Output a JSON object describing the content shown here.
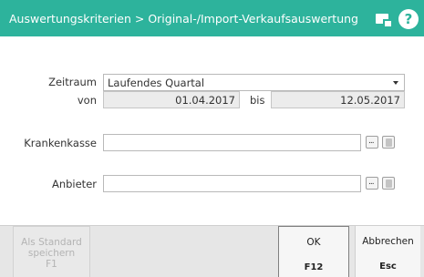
{
  "window": {
    "title": "Auswertungskriterien > Original-/Import-Verkaufsauswertung",
    "accent_color": "#2db39c",
    "icons": [
      "screen-icon",
      "help-icon"
    ]
  },
  "form": {
    "zeitraum": {
      "label": "Zeitraum",
      "value": "Laufendes Quartal"
    },
    "von": {
      "label": "von",
      "value": "01.04.2017"
    },
    "bis": {
      "label": "bis",
      "value": "12.05.2017"
    },
    "krankenkasse": {
      "label": "Krankenkasse",
      "value": ""
    },
    "anbieter": {
      "label": "Anbieter",
      "value": ""
    },
    "select_button_text": "...",
    "icons": [
      "chevron-down-icon",
      "ellipsis-icon",
      "trash-icon"
    ]
  },
  "footer": {
    "standard_button": {
      "line1": "Als Standard",
      "line2": "speichern",
      "key": "F1",
      "enabled": false
    },
    "ok_button": {
      "label": "OK",
      "key": "F12"
    },
    "cancel_button": {
      "label": "Abbrechen",
      "key": "Esc"
    }
  }
}
